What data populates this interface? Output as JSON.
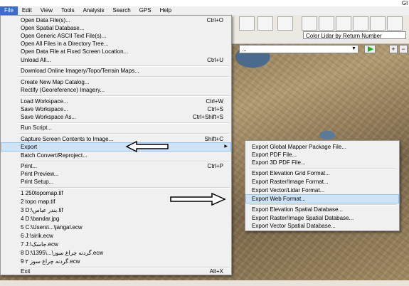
{
  "title": "Gl",
  "menubar": [
    "File",
    "Edit",
    "View",
    "Tools",
    "Analysis",
    "Search",
    "GPS",
    "Help"
  ],
  "toolbar": {
    "lidar_select": "Color Lidar by Return Number",
    "secondary_select": "..."
  },
  "file_menu": [
    {
      "label": "Open Data File(s)...",
      "shortcut": "Ctrl+O"
    },
    {
      "label": "Open Spatial Database...",
      "shortcut": ""
    },
    {
      "label": "Open Generic ASCII Text File(s)...",
      "shortcut": ""
    },
    {
      "label": "Open All Files in a Directory Tree...",
      "shortcut": ""
    },
    {
      "label": "Open Data File at Fixed Screen Location...",
      "shortcut": ""
    },
    {
      "label": "Unload All...",
      "shortcut": "Ctrl+U"
    },
    {
      "label": "Download Online Imagery/Topo/Terrain Maps...",
      "shortcut": ""
    },
    {
      "label": "Create New Map Catalog...",
      "shortcut": ""
    },
    {
      "label": "Rectify (Georeference) Imagery...",
      "shortcut": ""
    },
    {
      "label": "Load Workspace...",
      "shortcut": "Ctrl+W"
    },
    {
      "label": "Save Workspace...",
      "shortcut": "Ctrl+S"
    },
    {
      "label": "Save Workspace As...",
      "shortcut": "Ctrl+Shift+S"
    },
    {
      "label": "Run Script...",
      "shortcut": ""
    },
    {
      "label": "Capture Screen Contents to Image...",
      "shortcut": "Shift+C"
    },
    {
      "label": "Export",
      "shortcut": ""
    },
    {
      "label": "Batch Convert/Reproject...",
      "shortcut": ""
    },
    {
      "label": "Print...",
      "shortcut": "Ctrl+P"
    },
    {
      "label": "Print Preview...",
      "shortcut": ""
    },
    {
      "label": "Print Setup...",
      "shortcut": ""
    },
    {
      "label": "1 250topomap.tif",
      "shortcut": ""
    },
    {
      "label": "2 topo map.tif",
      "shortcut": ""
    },
    {
      "label": "3 D:\\بندر عباس.tif",
      "shortcut": ""
    },
    {
      "label": "4 D:\\bandar.jpg",
      "shortcut": ""
    },
    {
      "label": "5 C:\\Users\\...\\jangal.ecw",
      "shortcut": ""
    },
    {
      "label": "6 J:\\sirik.ecw",
      "shortcut": ""
    },
    {
      "label": "7 J:\\جاسک.ecw",
      "shortcut": ""
    },
    {
      "label": "8 D:\\1395\\...\\گردنه چراغ سوز.ecw",
      "shortcut": ""
    },
    {
      "label": "9 گردنه چراغ سوز ۲.ecw",
      "shortcut": ""
    },
    {
      "label": "Exit",
      "shortcut": "Alt+X"
    }
  ],
  "export_menu": [
    "Export Global Mapper Package File...",
    "Export PDF File...",
    "Export 3D PDF File...",
    "Export Elevation Grid Format...",
    "Export Raster/Image Format...",
    "Export Vector/Lidar Format...",
    "Export Web Format...",
    "Export Elevation Spatial Database...",
    "Export Raster/Image Spatial Database...",
    "Export Vector Spatial Database..."
  ],
  "colors": {
    "highlight": "#cfe3f7",
    "menu_bg": "#f0f0f0",
    "active_menu": "#3a6ec9",
    "go_green": "#1cae1c"
  }
}
